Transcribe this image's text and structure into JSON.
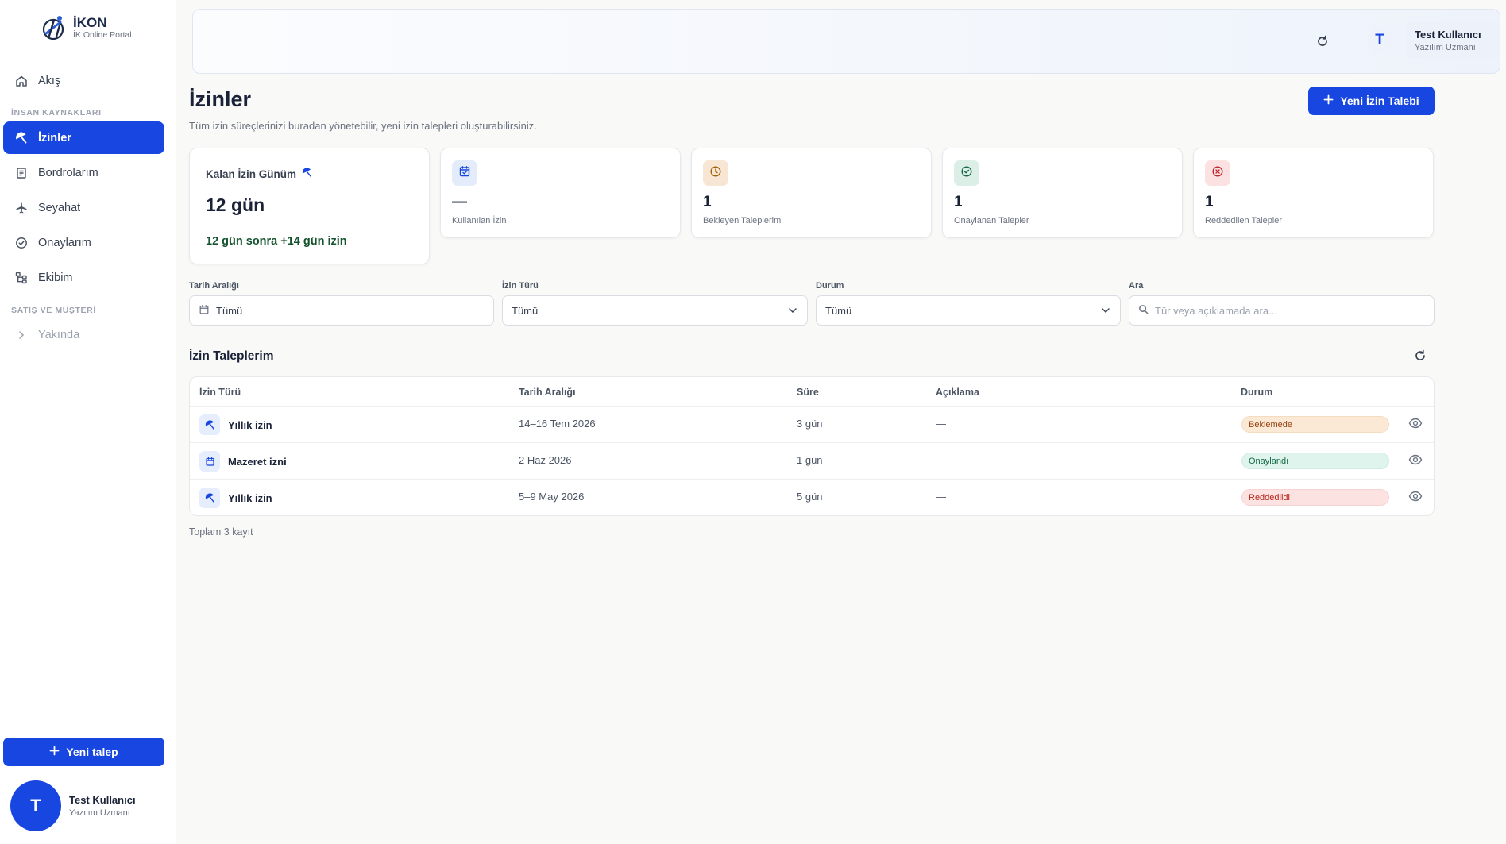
{
  "brand": {
    "name": "İKON",
    "subtitle": "İK Online Portal"
  },
  "sidebar": {
    "items": [
      {
        "label": "Akış",
        "icon": "home-icon"
      },
      {
        "label": "İzinler",
        "icon": "beach-umbrella-icon"
      },
      {
        "label": "Bordrolarım",
        "icon": "receipt-icon"
      },
      {
        "label": "Seyahat",
        "icon": "plane-icon"
      },
      {
        "label": "Onaylarım",
        "icon": "check-circle-icon"
      },
      {
        "label": "Ekibim",
        "icon": "org-chart-icon"
      },
      {
        "label": "Yakında",
        "icon": "chevron-right-icon"
      }
    ],
    "section_hr": "İNSAN KAYNAKLARI",
    "section_sales": "SATIŞ VE MÜŞTERİ",
    "new_request": "Yeni talep",
    "user": {
      "initial": "T",
      "name": "Test Kullanıcı",
      "role": "Yazılım Uzmanı"
    }
  },
  "header": {
    "user": {
      "initial": "T",
      "name": "Test Kullanıcı",
      "role": "Yazılım Uzmanı"
    }
  },
  "page": {
    "title": "İzinler",
    "subtitle": "Tüm izin süreçlerinizi buradan yönetebilir, yeni izin talepleri oluşturabilirsiniz.",
    "new_button": "Yeni İzin Talebi"
  },
  "stats": {
    "remaining": {
      "label": "Kalan İzin Günüm",
      "value": "12 gün",
      "accrual": "12 gün sonra +14 gün izin"
    },
    "cards": [
      {
        "value": "—",
        "label": "Kullanılan İzin",
        "icon": "calendar-check-icon",
        "badge_bg": "#e4ecfc",
        "icon_color": "#1846e0"
      },
      {
        "value": "1",
        "label": "Bekleyen Taleplerim",
        "icon": "clock-icon",
        "badge_bg": "#f8e6d4",
        "icon_color": "#a16207"
      },
      {
        "value": "1",
        "label": "Onaylanan Talepler",
        "icon": "check-circle-icon",
        "badge_bg": "#dcefe6",
        "icon_color": "#166a48"
      },
      {
        "value": "1",
        "label": "Reddedilen Talepler",
        "icon": "x-circle-icon",
        "badge_bg": "#fbe1e1",
        "icon_color": "#c0262d"
      }
    ]
  },
  "filters": {
    "date_range": {
      "label": "Tarih Aralığı",
      "value": "Tümü"
    },
    "leave_type": {
      "label": "İzin Türü",
      "value": "Tümü"
    },
    "status": {
      "label": "Durum",
      "value": "Tümü"
    },
    "search": {
      "label": "Ara",
      "placeholder": "Tür veya açıklamada ara..."
    }
  },
  "table": {
    "title": "İzin Taleplerim",
    "columns": [
      "İzin Türü",
      "Tarih Aralığı",
      "Süre",
      "Açıklama",
      "Durum"
    ],
    "rows": [
      {
        "type": "Yıllık izin",
        "icon": "beach-umbrella-icon",
        "dates": "14–16 Tem 2026",
        "duration": "3 gün",
        "note": "—",
        "status": "Beklemede",
        "status_kind": "pending"
      },
      {
        "type": "Mazeret izni",
        "icon": "calendar-icon",
        "dates": "2 Haz 2026",
        "duration": "1 gün",
        "note": "—",
        "status": "Onaylandı",
        "status_kind": "approved"
      },
      {
        "type": "Yıllık izin",
        "icon": "beach-umbrella-icon",
        "dates": "5–9 May 2026",
        "duration": "5 gün",
        "note": "—",
        "status": "Reddedildi",
        "status_kind": "rejected"
      }
    ],
    "total": "Toplam 3 kayıt"
  }
}
